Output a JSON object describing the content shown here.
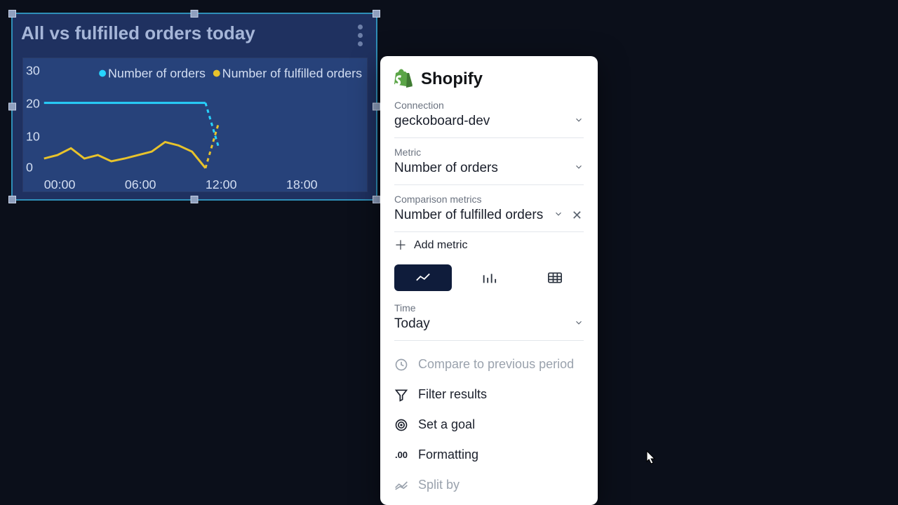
{
  "widget": {
    "title": "All vs fulfilled orders today",
    "legend": [
      "Number of orders",
      "Number of fulfilled orders"
    ]
  },
  "chart_data": {
    "type": "line",
    "x": [
      "00:00",
      "01:00",
      "02:00",
      "03:00",
      "04:00",
      "05:00",
      "06:00",
      "07:00",
      "08:00",
      "09:00",
      "10:00",
      "11:00",
      "12:00",
      "13:00"
    ],
    "x_ticks_shown": [
      "00:00",
      "06:00",
      "12:00",
      "18:00"
    ],
    "series": [
      {
        "name": "Number of orders",
        "color": "#27d4ff",
        "values": [
          20,
          20,
          20,
          20,
          20,
          20,
          20,
          20,
          20,
          20,
          20,
          20,
          20,
          6
        ],
        "dashed_from_index": 12
      },
      {
        "name": "Number of fulfilled orders",
        "color": "#e8c32b",
        "values": [
          3,
          4,
          6,
          3,
          4,
          2,
          3,
          4,
          5,
          8,
          7,
          5,
          0,
          14
        ],
        "dashed_from_index": 12
      }
    ],
    "ylim": [
      0,
      30
    ],
    "y_ticks": [
      0,
      10,
      20,
      30
    ],
    "xlabel": "",
    "ylabel": "",
    "title": ""
  },
  "panel": {
    "title": "Shopify",
    "connection_label": "Connection",
    "connection_value": "geckoboard-dev",
    "metric_label": "Metric",
    "metric_value": "Number of orders",
    "comparison_label": "Comparison metrics",
    "comparison_value": "Number of fulfilled orders",
    "add_metric_label": "Add metric",
    "time_label": "Time",
    "time_value": "Today",
    "options": {
      "compare": "Compare to previous period",
      "filter": "Filter results",
      "goal": "Set a goal",
      "formatting": "Formatting",
      "splitby": "Split by"
    },
    "formatting_icon_text": ".00"
  }
}
